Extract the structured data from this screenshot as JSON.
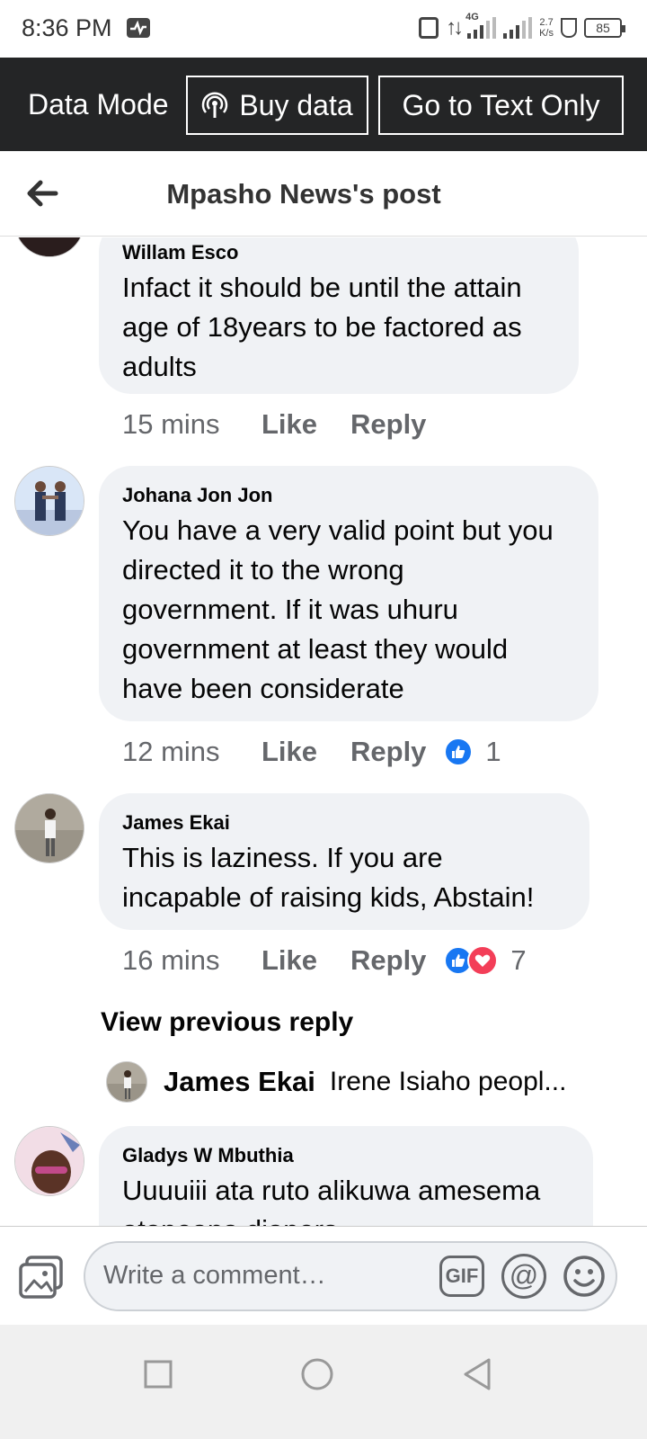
{
  "status_bar": {
    "time": "8:36 PM",
    "network": "4G",
    "speed_value": "2.7",
    "speed_unit": "K/s",
    "battery": "85"
  },
  "data_bar": {
    "label": "Data Mode",
    "buy_data": "Buy data",
    "text_only": "Go to Text Only"
  },
  "header": {
    "title": "Mpasho News's post"
  },
  "comments": [
    {
      "name": "Willam Esco",
      "lines": [
        "Infact it should be until the attain",
        "age of 18years to be factored as",
        "adults"
      ],
      "time": "15 mins",
      "like": "Like",
      "reply": "Reply",
      "reactions": ""
    },
    {
      "name": "Johana Jon Jon",
      "lines": [
        "You have a very valid point but you",
        "directed it to the wrong",
        "government. If it was uhuru",
        "government at least they would",
        "have been considerate"
      ],
      "time": "12 mins",
      "like": "Like",
      "reply": "Reply",
      "reactions": "1"
    },
    {
      "name": "James Ekai",
      "lines": [
        "This is laziness. If you are",
        "incapable of raising kids, Abstain!"
      ],
      "time": "16 mins",
      "like": "Like",
      "reply": "Reply",
      "reactions": "7"
    },
    {
      "name": "Gladys W Mbuthia",
      "lines": [
        "Uuuuiii ata ruto alikuwa amesema",
        "atapeana diapers"
      ]
    }
  ],
  "view_previous": "View previous reply",
  "reply_preview": {
    "name": "James Ekai",
    "text": "Irene Isiaho peopl..."
  },
  "composer": {
    "placeholder": "Write a comment…",
    "gif": "GIF",
    "at": "@"
  },
  "colors": {
    "like_blue": "#1877f2",
    "love_red": "#f33e58",
    "bubble": "#f0f2f5",
    "databar": "#242526"
  },
  "icons": [
    "back-arrow-icon",
    "antenna-icon",
    "photo-icon",
    "gif-icon",
    "mention-icon",
    "emoji-icon",
    "like-reaction-icon",
    "love-reaction-icon",
    "nav-square-icon",
    "nav-circle-icon",
    "nav-back-triangle-icon"
  ]
}
